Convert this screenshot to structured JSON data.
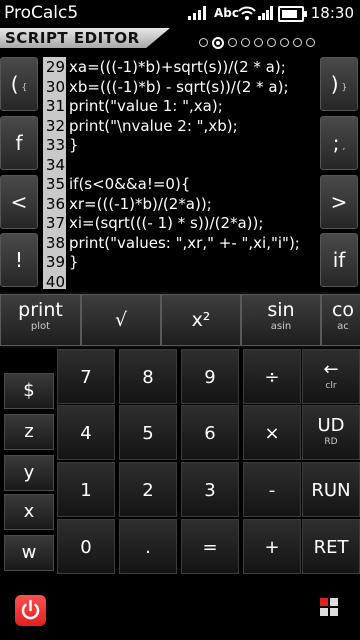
{
  "status_bar": {
    "app_name": "ProCalc5",
    "network_label": "Abc",
    "time": "18:30",
    "battery_level": 0.85
  },
  "header": {
    "title": "SCRIPT EDITOR",
    "page_count": 9,
    "active_page": 2
  },
  "left_keys": [
    {
      "label": "(",
      "sub": "{"
    },
    {
      "label": "f",
      "sub": ""
    },
    {
      "label": "<",
      "sub": ""
    },
    {
      "label": "!",
      "sub": ""
    }
  ],
  "right_keys": [
    {
      "label": ")",
      "sub": "}"
    },
    {
      "label": ";",
      "sub": ","
    },
    {
      "label": ">",
      "sub": ""
    },
    {
      "label": "if",
      "sub": ""
    }
  ],
  "editor": {
    "lines": [
      {
        "num": "29",
        "text": "xa=(((-1)*b)+sqrt(s))/(2 * a);"
      },
      {
        "num": "30",
        "text": "xb=(((-1)*b) - sqrt(s))/(2 * a);"
      },
      {
        "num": "31",
        "text": "print(\"value 1: \",xa);"
      },
      {
        "num": "32",
        "text": "print(\"\\nvalue 2: \",xb);"
      },
      {
        "num": "33",
        "text": "}"
      },
      {
        "num": "34",
        "text": ""
      },
      {
        "num": "35",
        "text": "if(s<0&&a!=0){"
      },
      {
        "num": "36",
        "text": "xr=(((-1)*b)/(2*a));"
      },
      {
        "num": "37",
        "text": "xi=(sqrt(((- 1) * s))/(2*a));"
      },
      {
        "num": "38",
        "text": "print(\"values: \",xr,\" +- \",xi,\"i\");"
      },
      {
        "num": "39",
        "text": "}"
      },
      {
        "num": "40",
        "text": ""
      }
    ]
  },
  "function_keys": [
    {
      "label": "print",
      "sub": "plot"
    },
    {
      "label": "√",
      "sub": ""
    },
    {
      "label": "x²",
      "sub": ""
    },
    {
      "label": "sin",
      "sub": "asin"
    },
    {
      "label": "co",
      "sub": "ac"
    }
  ],
  "var_keys": [
    "$",
    "z",
    "y",
    "x",
    "w"
  ],
  "keypad": [
    [
      {
        "label": "7",
        "sub": ""
      },
      {
        "label": "8",
        "sub": ""
      },
      {
        "label": "9",
        "sub": ""
      },
      {
        "label": "÷",
        "sub": ""
      },
      {
        "label": "←",
        "sub": "clr"
      }
    ],
    [
      {
        "label": "4",
        "sub": ""
      },
      {
        "label": "5",
        "sub": ""
      },
      {
        "label": "6",
        "sub": ""
      },
      {
        "label": "×",
        "sub": ""
      },
      {
        "label": "UD",
        "sub": "RD"
      }
    ],
    [
      {
        "label": "1",
        "sub": ""
      },
      {
        "label": "2",
        "sub": ""
      },
      {
        "label": "3",
        "sub": ""
      },
      {
        "label": "-",
        "sub": ""
      },
      {
        "label": "RUN",
        "sub": ""
      }
    ],
    [
      {
        "label": "0",
        "sub": ""
      },
      {
        "label": ".",
        "sub": ""
      },
      {
        "label": "=",
        "sub": ""
      },
      {
        "label": "+",
        "sub": ""
      },
      {
        "label": "RET",
        "sub": ""
      }
    ]
  ],
  "colors": {
    "power_button": "#e02020",
    "menu_squares": [
      "#e02020",
      "#dddddd",
      "#dddddd",
      "#dddddd"
    ]
  }
}
